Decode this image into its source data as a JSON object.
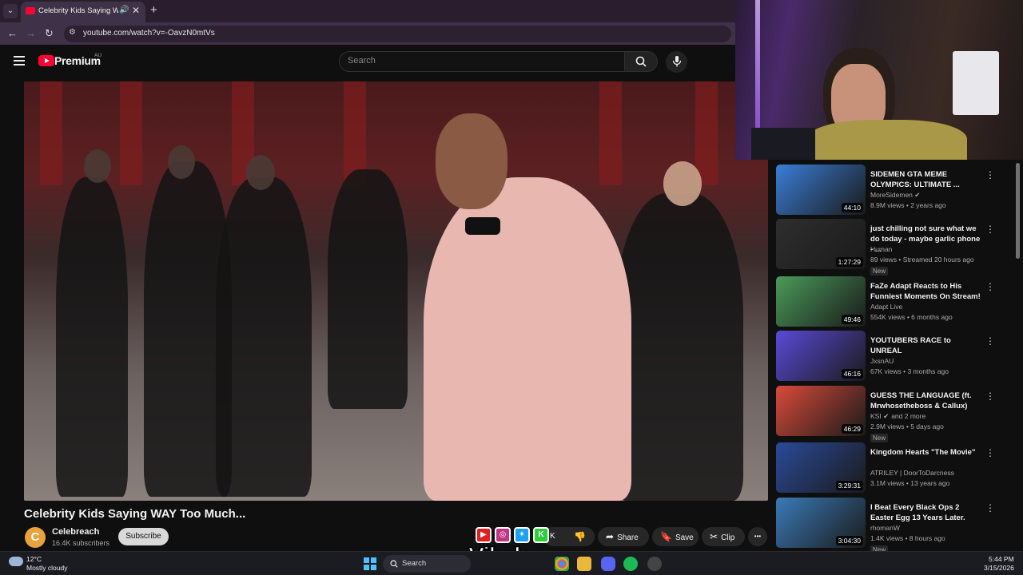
{
  "browser": {
    "tab_title": "Celebrity Kids Saying WAY T",
    "url": "youtube.com/watch?v=-OavzN0mtVs",
    "new_tab": "+",
    "tab_close": "✕"
  },
  "youtube": {
    "brand": "Premium",
    "country": "AU",
    "search_placeholder": "Search"
  },
  "video": {
    "title": "Celebrity Kids Saying WAY Too Much...",
    "channel_initial": "C",
    "channel": "Celebreach",
    "subscribers": "16.4K subscribers",
    "subscribe_label": "Subscribe",
    "likes": "K",
    "share_label": "Share",
    "save_label": "Save",
    "clip_label": "Clip",
    "more_label": "•••"
  },
  "overlay": {
    "brand": "Vibzlo",
    "socials": [
      "youtube-icon",
      "instagram-icon",
      "twitter-icon",
      "kick-icon"
    ]
  },
  "recommendations": [
    {
      "title": "SIDEMEN GTA MEME OLYMPICS: ULTIMATE ...",
      "channel": "MoreSidemen",
      "verified": true,
      "meta": "8.9M views • 2 years ago",
      "duration": "44:10",
      "new": false,
      "thumb_color": "#3a7ed8"
    },
    {
      "title": "just chilling not sure what we do today - maybe garlic phone - ...",
      "channel": "Human",
      "verified": false,
      "meta": "89 views • Streamed 20 hours ago",
      "duration": "1:27:29",
      "new": true,
      "thumb_color": "#2e2e2e"
    },
    {
      "title": "FaZe Adapt Reacts to His Funniest Moments On Stream!",
      "channel": "Adapt Live",
      "verified": false,
      "meta": "554K views • 6 months ago",
      "duration": "49:46",
      "new": false,
      "thumb_color": "#4a9a5a"
    },
    {
      "title": "YOUTUBERS RACE to UNREAL",
      "channel": "JxsnAU",
      "verified": false,
      "meta": "67K views • 3 months ago",
      "duration": "46:16",
      "new": false,
      "thumb_color": "#5a4ad8"
    },
    {
      "title": "GUESS THE LANGUAGE (ft. Mrwhosetheboss & Callux)",
      "channel": "KSI",
      "verified": true,
      "channel_extra": "and 2 more",
      "meta": "2.9M views • 5 days ago",
      "duration": "46:29",
      "new": true,
      "thumb_color": "#d84a3a"
    },
    {
      "title": "Kingdom Hearts \"The Movie\"",
      "channel": "ATRILEY | DoorToDarcness",
      "verified": false,
      "meta": "3.1M views • 13 years ago",
      "duration": "3:29:31",
      "new": false,
      "thumb_color": "#2a4a9a"
    },
    {
      "title": "I Beat Every Black Ops 2 Easter Egg 13 Years Later.",
      "channel": "rhomanW",
      "verified": false,
      "meta": "1.4K views • 8 hours ago",
      "duration": "3:04:30",
      "new": true,
      "thumb_color": "#3a7ab8"
    }
  ],
  "new_badge": "New",
  "taskbar": {
    "temp": "12°C",
    "weather": "Mostly cloudy",
    "search": "Search",
    "time": "5:44 PM",
    "date": "3/15/2026"
  }
}
